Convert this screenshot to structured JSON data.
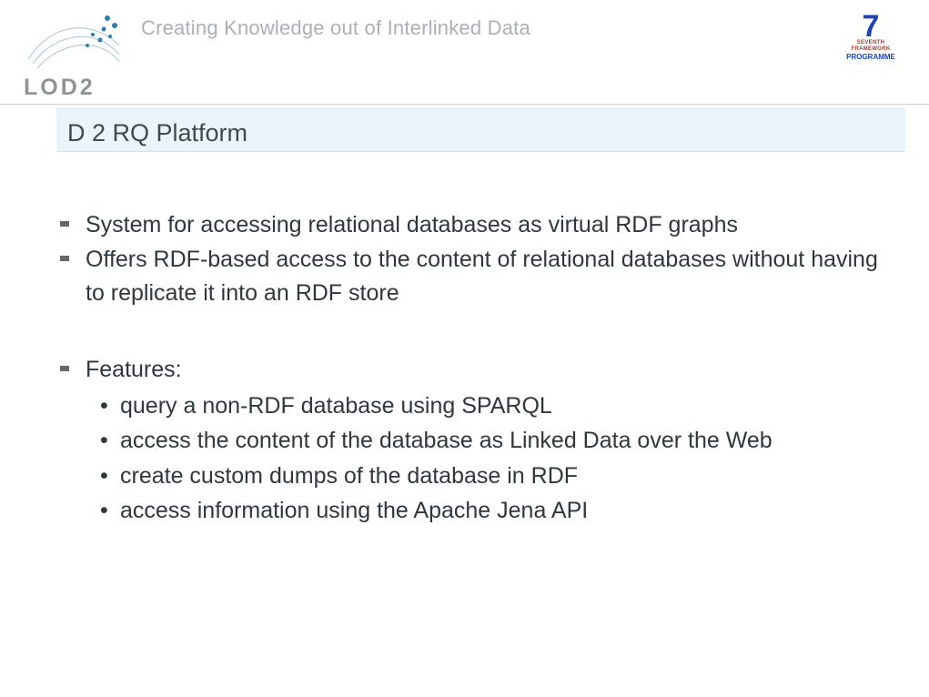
{
  "header": {
    "tagline": "Creating Knowledge out of Interlinked Data",
    "logo_text": "LOD2",
    "fp7_top": "7",
    "fp7_mid": "SEVENTH FRAMEWORK",
    "fp7_bot": "PROGRAMME"
  },
  "title": "D 2 RQ Platform",
  "bullets": [
    {
      "text": "System for accessing relational databases as virtual RDF graphs"
    },
    {
      "text": "Offers RDF-based access to the content of relational databases without having to replicate it into an RDF store"
    },
    {
      "text": "Features:",
      "spaced": true,
      "sub": [
        "query a non-RDF database using SPARQL",
        "access the content of the database as Linked Data over the Web",
        "create custom dumps of the database in RDF",
        "access information using the Apache Jena API"
      ]
    }
  ]
}
